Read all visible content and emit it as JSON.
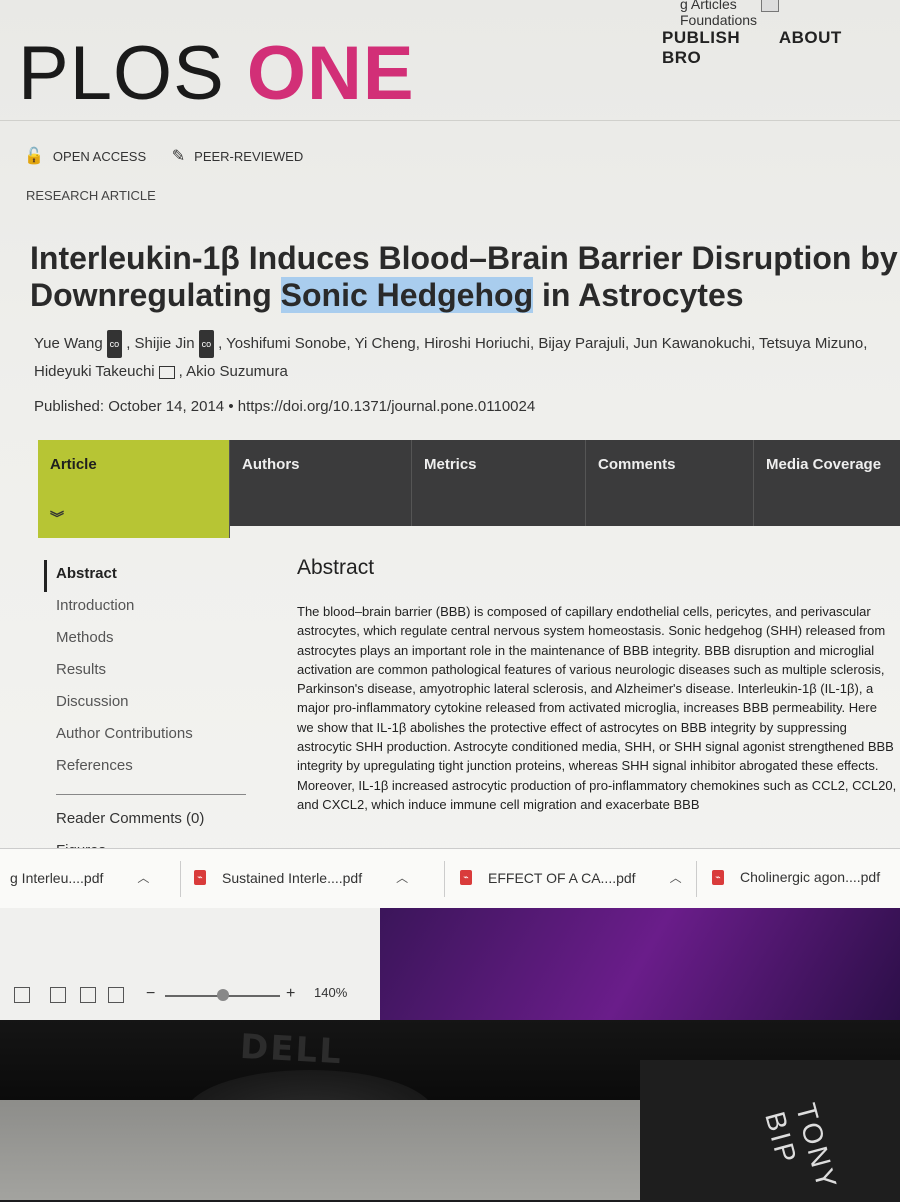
{
  "browser": {
    "bookmarks": [
      {
        "label": "g Articles"
      },
      {
        "label": "Foundations"
      }
    ]
  },
  "site": {
    "brand_part1": "PLOS",
    "brand_part2": "ONE",
    "brand_color": "#d22f77",
    "nav": [
      "PUBLISH",
      "ABOUT",
      "BRO"
    ]
  },
  "article": {
    "badges": [
      {
        "icon": "lock-open-icon",
        "label": "OPEN ACCESS"
      },
      {
        "icon": "peer-reviewed-icon",
        "label": "PEER-REVIEWED"
      }
    ],
    "type": "RESEARCH ARTICLE",
    "title_before": "Interleukin-1β Induces Blood–Brain Barrier Disruption by Downregulating ",
    "title_highlight": "Sonic Hedgehog",
    "title_after": " in Astrocytes",
    "authors": [
      {
        "name": "Yue Wang",
        "badge": "co"
      },
      {
        "name": "Shijie Jin",
        "badge": "co"
      },
      {
        "name": "Yoshifumi Sonobe"
      },
      {
        "name": "Yi Cheng"
      },
      {
        "name": "Hiroshi Horiuchi"
      },
      {
        "name": "Bijay Parajuli"
      },
      {
        "name": "Jun Kawanokuchi"
      },
      {
        "name": "Tetsuya Mizuno"
      },
      {
        "name": "Hideyuki Takeuchi",
        "mail": true
      },
      {
        "name": "Akio Suzumura"
      }
    ],
    "published_label": "Published:",
    "published_date": "October 14, 2014",
    "doi": "https://doi.org/10.1371/journal.pone.0110024"
  },
  "tabs": [
    {
      "label": "Article",
      "active": true
    },
    {
      "label": "Authors"
    },
    {
      "label": "Metrics"
    },
    {
      "label": "Comments"
    },
    {
      "label": "Media Coverage"
    }
  ],
  "tab_accent": "#b7c534",
  "sidenav": {
    "items": [
      "Abstract",
      "Introduction",
      "Methods",
      "Results",
      "Discussion",
      "Author Contributions",
      "References"
    ],
    "reader_comments": "Reader Comments (0)",
    "figures": "Figures"
  },
  "abstract": {
    "heading": "Abstract",
    "text": "The blood–brain barrier (BBB) is composed of capillary endothelial cells, pericytes, and perivascular astrocytes, which regulate central nervous system homeostasis. Sonic hedgehog (SHH) released from astrocytes plays an important role in the maintenance of BBB integrity. BBB disruption and microglial activation are common pathological features of various neurologic diseases such as multiple sclerosis, Parkinson's disease, amyotrophic lateral sclerosis, and Alzheimer's disease. Interleukin-1β (IL-1β), a major pro-inflammatory cytokine released from activated microglia, increases BBB permeability. Here we show that IL-1β abolishes the protective effect of astrocytes on BBB integrity by suppressing astrocytic SHH production. Astrocyte conditioned media, SHH, or SHH signal agonist strengthened BBB integrity by upregulating tight junction proteins, whereas SHH signal inhibitor abrogated these effects. Moreover, IL-1β increased astrocytic production of pro-inflammatory chemokines such as CCL2, CCL20, and CXCL2, which induce immune cell migration and exacerbate BBB"
  },
  "downloads": [
    {
      "label": "g Interleu....pdf"
    },
    {
      "label": "Sustained Interle....pdf"
    },
    {
      "label": "EFFECT OF A CA....pdf"
    },
    {
      "label": "Cholinergic agon....pdf"
    }
  ],
  "statusbar": {
    "zoom": "140%",
    "zoom_level": 0.5
  },
  "monitor": {
    "brand": "DELL"
  },
  "desk_box_text": "TONY BIP"
}
